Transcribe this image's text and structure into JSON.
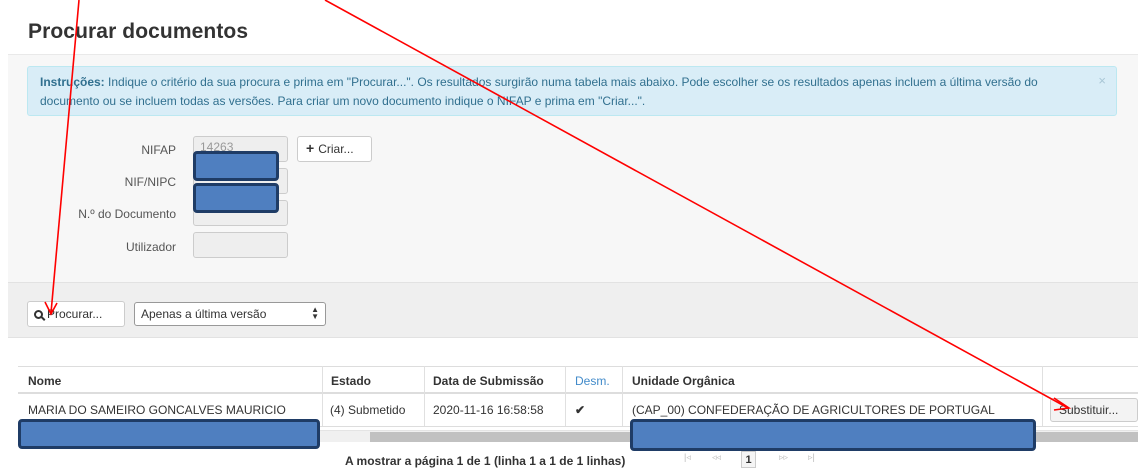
{
  "page": {
    "title": "Procurar documentos"
  },
  "alert": {
    "prefix": "Instruções:",
    "line1": " Indique o critério da sua procura e prima em \"Procurar...\". Os resultados surgirão numa tabela mais abaixo. Pode escolher se os resultados apenas incluem a última versão do",
    "line2": "documento ou se incluem todas as versões. Para criar um novo documento indique o NIFAP e prima em \"Criar...\".",
    "close": "×"
  },
  "form": {
    "nifap_label": "NIFAP",
    "nifap_value": "14263",
    "nif_label": "NIF/NIPC",
    "doc_label": "N.º do Documento",
    "user_label": "Utilizador",
    "criar_label": "Criar..."
  },
  "search": {
    "button_label": "Procurar...",
    "version_selected": "Apenas a última versão"
  },
  "table": {
    "columns": [
      "Nome",
      "Estado",
      "Data de Submissão",
      "Desm.",
      "Unidade Orgânica"
    ],
    "rows": [
      {
        "nome": "MARIA DO SAMEIRO GONCALVES MAURICIO",
        "estado": "(4) Submetido",
        "data": "2020-11-16 16:58:58",
        "desm": "✔",
        "unidade": "(CAP_00) CONFEDERAÇÃO DE AGRICULTORES DE PORTUGAL",
        "action": "Substituir..."
      }
    ]
  },
  "pager": {
    "text": "A mostrar a página 1 de 1 (linha 1 a 1 de 1 linhas)",
    "first": "|◃",
    "prev": "◃◃",
    "current": "1",
    "next": "▹▹",
    "last": "▹|"
  },
  "colors": {
    "annotation_red": "#ff0000",
    "redaction_fill": "#4f7fc0",
    "redaction_border": "#1f3c66",
    "alert_bg": "#d9edf7"
  }
}
